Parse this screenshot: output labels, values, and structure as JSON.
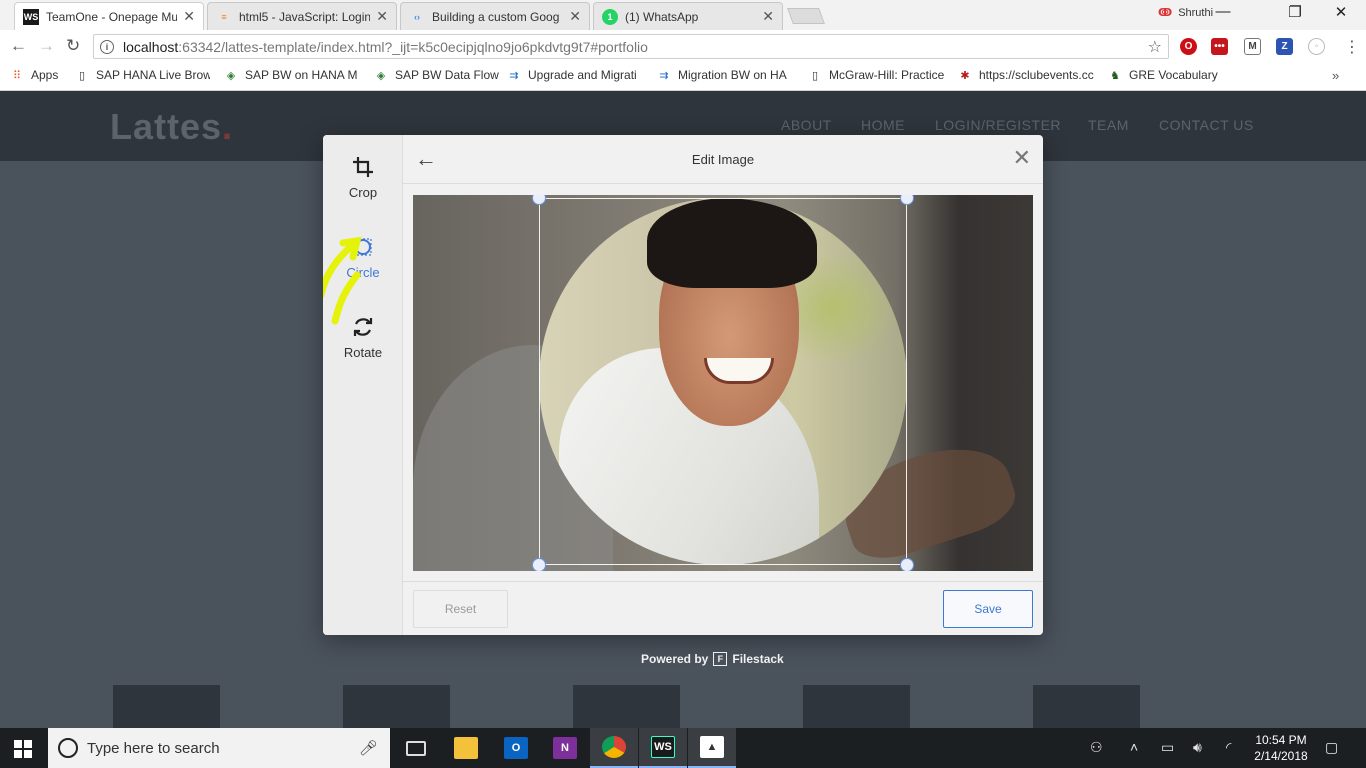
{
  "browser": {
    "tabs": [
      {
        "label": "TeamOne - Onepage Mu",
        "icon": "webstorm-icon",
        "active": true
      },
      {
        "label": "html5 - JavaScript: Login",
        "icon": "stackoverflow-icon",
        "active": false
      },
      {
        "label": "Building a custom Goog",
        "icon": "google-dev-icon",
        "active": false
      },
      {
        "label": "(1) WhatsApp",
        "icon": "whatsapp-icon",
        "active": false
      }
    ],
    "profile_name": "Shruthi",
    "url_host": "localhost",
    "url_path": ":63342/lattes-template/index.html?_ijt=k5c0ecipjqlno9jo6pkdvtg9t7#portfolio",
    "bookmarks": [
      {
        "label": "Apps",
        "icon": "apps-grid-icon"
      },
      {
        "label": "SAP HANA Live Brow",
        "icon": "page-icon"
      },
      {
        "label": "SAP BW on HANA M",
        "icon": "diamond-icon"
      },
      {
        "label": "SAP BW Data Flow",
        "icon": "diamond-icon"
      },
      {
        "label": "Upgrade and Migrati",
        "icon": "sap-icon"
      },
      {
        "label": "Migration BW on HA",
        "icon": "sap-icon"
      },
      {
        "label": "McGraw-Hill: Practice",
        "icon": "page-icon"
      },
      {
        "label": "https://sclubevents.cc",
        "icon": "spider-icon"
      },
      {
        "label": "GRE Vocabulary",
        "icon": "spartan-icon"
      }
    ],
    "bookmarks_overflow": "»"
  },
  "site": {
    "logo_text": "Lattes",
    "logo_dot": ".",
    "nav": [
      "ABOUT",
      "HOME",
      "LOGIN/REGISTER",
      "TEAM",
      "CONTACT US"
    ]
  },
  "editor": {
    "title": "Edit Image",
    "tools": [
      {
        "label": "Crop",
        "icon": "crop-icon",
        "active": false
      },
      {
        "label": "Circle",
        "icon": "circle-crop-icon",
        "active": true
      },
      {
        "label": "Rotate",
        "icon": "rotate-icon",
        "active": false
      }
    ],
    "reset_label": "Reset",
    "save_label": "Save",
    "accent_color": "#3f77d6",
    "powered_prefix": "Powered by",
    "powered_brand": "Filestack"
  },
  "taskbar": {
    "search_placeholder": "Type here to search",
    "apps": [
      "task-view-icon",
      "file-explorer-icon",
      "outlook-icon",
      "onenote-icon",
      "chrome-icon",
      "webstorm-icon",
      "photos-icon"
    ],
    "time": "10:54 PM",
    "date": "2/14/2018"
  }
}
